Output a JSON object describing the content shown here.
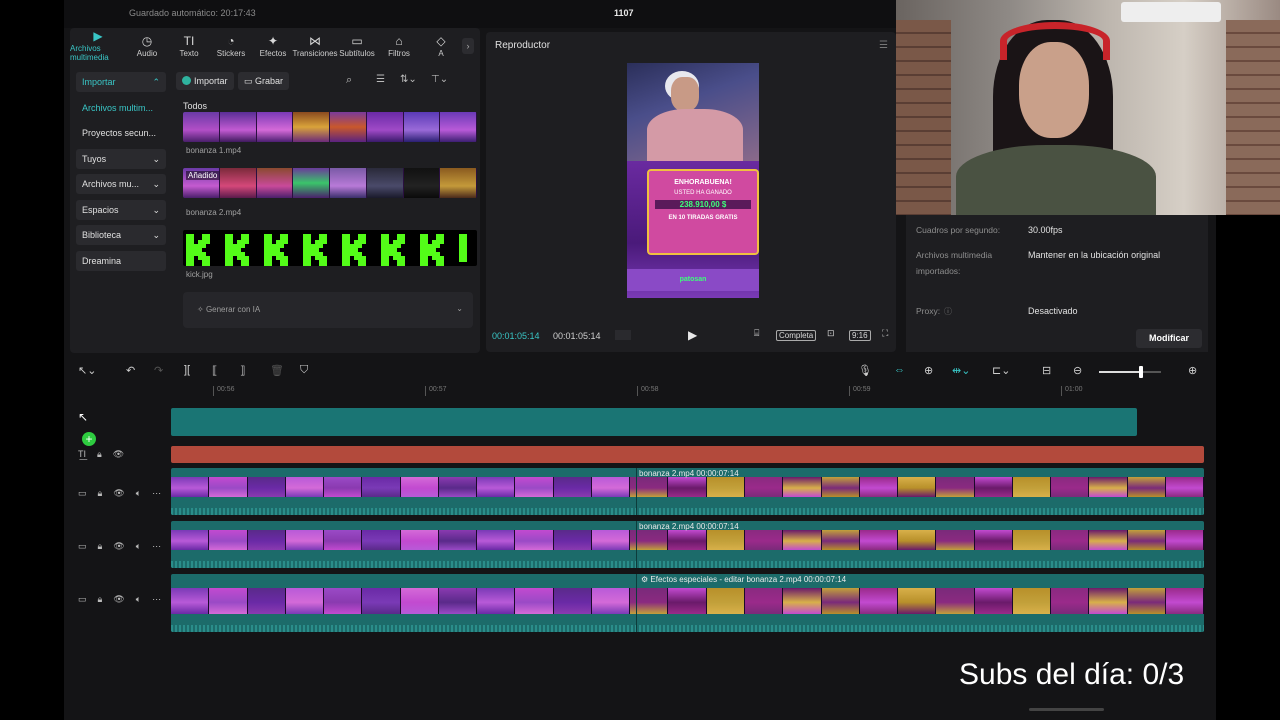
{
  "topbar": {
    "autosave": "Guardado automático: 20:17:43",
    "project_name": "1107"
  },
  "media_toolbar": [
    {
      "label": "Archivos multimedia",
      "icon": "media-icon",
      "glyph": "▶",
      "active": true
    },
    {
      "label": "Audio",
      "icon": "audio-icon",
      "glyph": "◷",
      "active": false
    },
    {
      "label": "Texto",
      "icon": "text-icon",
      "glyph": "TI",
      "active": false
    },
    {
      "label": "Stickers",
      "icon": "sticker-icon",
      "glyph": "◔",
      "active": false
    },
    {
      "label": "Efectos",
      "icon": "effects-icon",
      "glyph": "✦",
      "active": false
    },
    {
      "label": "Transiciones",
      "icon": "transitions-icon",
      "glyph": "⋈",
      "active": false
    },
    {
      "label": "Subtítulos",
      "icon": "subtitles-icon",
      "glyph": "▭",
      "active": false
    },
    {
      "label": "Filtros",
      "icon": "filters-icon",
      "glyph": "⌂",
      "active": false
    },
    {
      "label": "A",
      "icon": "more-icon",
      "glyph": "◇",
      "active": false
    }
  ],
  "sidebar": [
    {
      "label": "Importar",
      "chevron": "⌃",
      "style": "hl teal"
    },
    {
      "label": "Archivos multim...",
      "chevron": "",
      "style": "sub"
    },
    {
      "label": "Proyectos secun...",
      "chevron": "",
      "style": ""
    },
    {
      "label": "Tuyos",
      "chevron": "⌄",
      "style": "hl"
    },
    {
      "label": "Archivos mu...",
      "chevron": "⌄",
      "style": "hl"
    },
    {
      "label": "Espacios",
      "chevron": "⌄",
      "style": "hl"
    },
    {
      "label": "Biblioteca",
      "chevron": "⌄",
      "style": "hl"
    },
    {
      "label": "Dreamina",
      "chevron": "",
      "style": "hl"
    }
  ],
  "media": {
    "import_label": "Importar",
    "record_label": "Grabar",
    "all_label": "Todos",
    "added_badge": "Añadido",
    "files": [
      {
        "name": "bonanza 1.mp4"
      },
      {
        "name": "bonanza 2.mp4"
      },
      {
        "name": "kick.jpg"
      }
    ],
    "generate_label": "Generar con IA"
  },
  "player": {
    "title": "Reproductor",
    "current_time": "00:01:05:14",
    "total_time": "00:01:05:14",
    "full_label": "Completa",
    "ratio_label": "9:16",
    "preview_text": {
      "line1": "ENHORABUENA!",
      "line2": "USTED HA GANADO",
      "amount": "238.910,00 $",
      "line3": "EN 10 TIRADAS GRATIS",
      "footer": "patosan"
    }
  },
  "details": {
    "fps_label": "Cuadros por segundo:",
    "fps_value": "30.00fps",
    "media_label": "Archivos multimedia importados:",
    "media_value": "Mantener en la ubicación original",
    "proxy_label": "Proxy:",
    "proxy_value": "Desactivado",
    "modify_label": "Modificar"
  },
  "ruler": {
    "ticks": [
      "00:56",
      "00:57",
      "00:58",
      "00:59",
      "01:00"
    ]
  },
  "tracks": [
    {
      "label": "bonanza 2.mp4  00:00:07:14",
      "prefix": ""
    },
    {
      "label": "bonanza 2.mp4  00:00:07:14",
      "prefix": ""
    },
    {
      "label": "bonanza 2.mp4  00:00:07:14",
      "prefix": "Efectos especiales - editar"
    }
  ],
  "overlay": {
    "subs": "Subs del día: 0/3"
  },
  "colors": {
    "accent": "#39c6c6",
    "panel": "#1e1e21",
    "text_track": "#b34a3c",
    "clip_teal": "#1c6b6a"
  }
}
